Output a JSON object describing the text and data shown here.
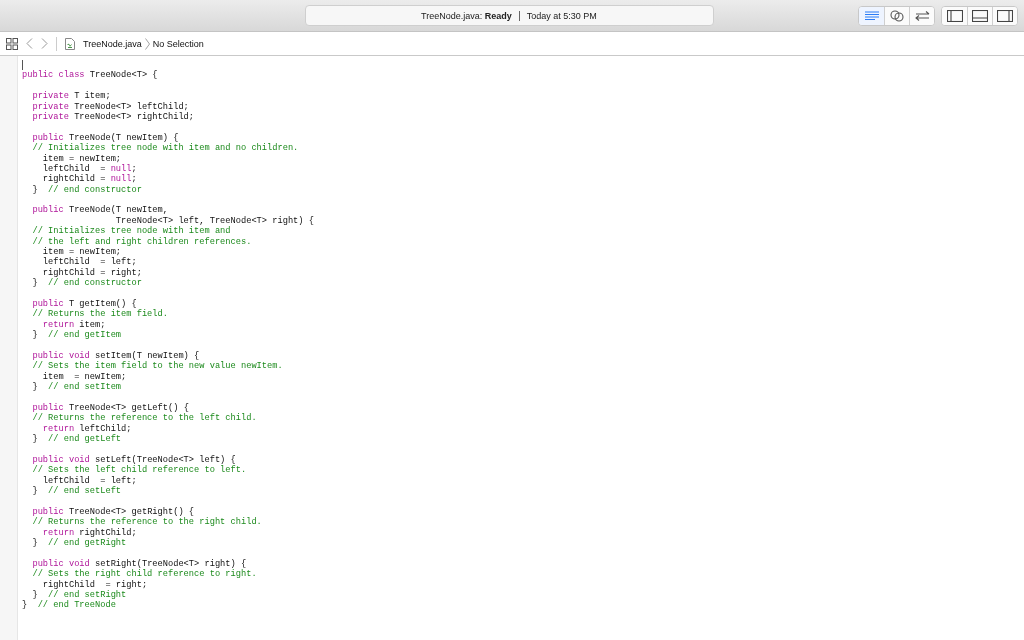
{
  "status": {
    "text": "TreeNode.java: **Ready**",
    "time": "Today at 5:30 PM"
  },
  "editor_modes": [
    {
      "kind": "standard",
      "selected": true
    },
    {
      "kind": "assistant",
      "selected": false
    },
    {
      "kind": "version",
      "selected": false
    }
  ],
  "panel_toggles": [
    {
      "kind": "left",
      "on": false
    },
    {
      "kind": "bottom",
      "on": false
    },
    {
      "kind": "right",
      "on": false
    }
  ],
  "breadcrumb": {
    "file": "TreeNode.java",
    "selection": "No Selection"
  },
  "blocks": [
    [
      [
        {
          "kind": "kw",
          "text": "public class"
        },
        {
          "kind": "plain",
          "text": " TreeNode<T> {"
        }
      ]
    ],
    [
      [
        {
          "kind": "kw",
          "text": "  private"
        },
        {
          "kind": "plain",
          "text": " T item;"
        }
      ],
      [
        {
          "kind": "kw",
          "text": "  private"
        },
        {
          "kind": "plain",
          "text": " TreeNode<T> leftChild;"
        }
      ],
      [
        {
          "kind": "kw",
          "text": "  private"
        },
        {
          "kind": "plain",
          "text": " TreeNode<T> rightChild;"
        }
      ]
    ],
    [
      [
        {
          "kind": "kw",
          "text": "  public"
        },
        {
          "kind": "plain",
          "text": " TreeNode(T newItem) {"
        }
      ],
      [
        {
          "kind": "comment",
          "text": "  // Initializes tree node with item and no children."
        }
      ],
      [
        {
          "kind": "plain",
          "text": "    item = newItem;"
        }
      ],
      [
        {
          "kind": "plain",
          "text": "    leftChild  = "
        },
        {
          "kind": "kw",
          "text": "null"
        },
        {
          "kind": "plain",
          "text": ";"
        }
      ],
      [
        {
          "kind": "plain",
          "text": "    rightChild = "
        },
        {
          "kind": "kw",
          "text": "null"
        },
        {
          "kind": "plain",
          "text": ";"
        }
      ],
      [
        {
          "kind": "plain",
          "text": "  }  "
        },
        {
          "kind": "comment",
          "text": "// end constructor"
        }
      ]
    ],
    [
      [
        {
          "kind": "kw",
          "text": "  public"
        },
        {
          "kind": "plain",
          "text": " TreeNode(T newItem,"
        }
      ],
      [
        {
          "kind": "plain",
          "text": "                  TreeNode<T> left, TreeNode<T> right) {"
        }
      ],
      [
        {
          "kind": "comment",
          "text": "  // Initializes tree node with item and"
        }
      ],
      [
        {
          "kind": "comment",
          "text": "  // the left and right children references."
        }
      ],
      [
        {
          "kind": "plain",
          "text": "    item = newItem;"
        }
      ],
      [
        {
          "kind": "plain",
          "text": "    leftChild  = left;"
        }
      ],
      [
        {
          "kind": "plain",
          "text": "    rightChild = right;"
        }
      ],
      [
        {
          "kind": "plain",
          "text": "  }  "
        },
        {
          "kind": "comment",
          "text": "// end constructor"
        }
      ]
    ],
    [
      [
        {
          "kind": "kw",
          "text": "  public"
        },
        {
          "kind": "plain",
          "text": " T getItem() {"
        }
      ],
      [
        {
          "kind": "comment",
          "text": "  // Returns the item field."
        }
      ],
      [
        {
          "kind": "kw",
          "text": "    return"
        },
        {
          "kind": "plain",
          "text": " item;"
        }
      ],
      [
        {
          "kind": "plain",
          "text": "  }  "
        },
        {
          "kind": "comment",
          "text": "// end getItem"
        }
      ]
    ],
    [
      [
        {
          "kind": "kw",
          "text": "  public void"
        },
        {
          "kind": "plain",
          "text": " setItem(T newItem) {"
        }
      ],
      [
        {
          "kind": "comment",
          "text": "  // Sets the item field to the new value newItem."
        }
      ],
      [
        {
          "kind": "plain",
          "text": "    item  = newItem;"
        }
      ],
      [
        {
          "kind": "plain",
          "text": "  }  "
        },
        {
          "kind": "comment",
          "text": "// end setItem"
        }
      ]
    ],
    [
      [
        {
          "kind": "kw",
          "text": "  public"
        },
        {
          "kind": "plain",
          "text": " TreeNode<T> getLeft() {"
        }
      ],
      [
        {
          "kind": "comment",
          "text": "  // Returns the reference to the left child."
        }
      ],
      [
        {
          "kind": "kw",
          "text": "    return"
        },
        {
          "kind": "plain",
          "text": " leftChild;"
        }
      ],
      [
        {
          "kind": "plain",
          "text": "  }  "
        },
        {
          "kind": "comment",
          "text": "// end getLeft"
        }
      ]
    ],
    [
      [
        {
          "kind": "kw",
          "text": "  public void"
        },
        {
          "kind": "plain",
          "text": " setLeft(TreeNode<T> left) {"
        }
      ],
      [
        {
          "kind": "comment",
          "text": "  // Sets the left child reference to left."
        }
      ],
      [
        {
          "kind": "plain",
          "text": "    leftChild  = left;"
        }
      ],
      [
        {
          "kind": "plain",
          "text": "  }  "
        },
        {
          "kind": "comment",
          "text": "// end setLeft"
        }
      ]
    ],
    [
      [
        {
          "kind": "kw",
          "text": "  public"
        },
        {
          "kind": "plain",
          "text": " TreeNode<T> getRight() {"
        }
      ],
      [
        {
          "kind": "comment",
          "text": "  // Returns the reference to the right child."
        }
      ],
      [
        {
          "kind": "kw",
          "text": "    return"
        },
        {
          "kind": "plain",
          "text": " rightChild;"
        }
      ],
      [
        {
          "kind": "plain",
          "text": "  }  "
        },
        {
          "kind": "comment",
          "text": "// end getRight"
        }
      ]
    ],
    [
      [
        {
          "kind": "kw",
          "text": "  public void"
        },
        {
          "kind": "plain",
          "text": " setRight(TreeNode<T> right) {"
        }
      ],
      [
        {
          "kind": "comment",
          "text": "  // Sets the right child reference to right."
        }
      ],
      [
        {
          "kind": "plain",
          "text": "    rightChild  = right;"
        }
      ],
      [
        {
          "kind": "plain",
          "text": "  }  "
        },
        {
          "kind": "comment",
          "text": "// end setRight"
        }
      ],
      [
        {
          "kind": "plain",
          "text": "}  "
        },
        {
          "kind": "comment",
          "text": "// end TreeNode"
        }
      ]
    ]
  ]
}
